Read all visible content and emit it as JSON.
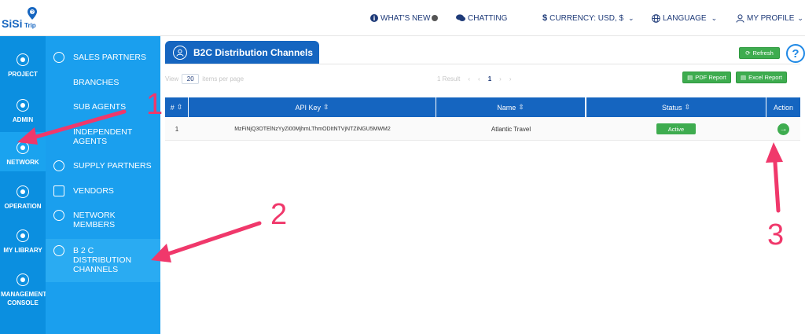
{
  "brand": {
    "name": "SiSi",
    "sub": "Trip"
  },
  "topnav": {
    "whats_new": "WHAT'S NEW",
    "chatting": "CHATTING",
    "currency": "CURRENCY: USD, $",
    "language": "LANGUAGE",
    "profile": "MY PROFILE"
  },
  "rail": [
    {
      "label": "PROJECT"
    },
    {
      "label": "ADMIN"
    },
    {
      "label": "NETWORK"
    },
    {
      "label": "OPERATION"
    },
    {
      "label": "MY LIBRARY"
    },
    {
      "label": "MANAGEMENT CONSOLE"
    }
  ],
  "submenu": [
    {
      "label": "SALES PARTNERS"
    },
    {
      "label": "BRANCHES"
    },
    {
      "label": "SUB AGENTS"
    },
    {
      "label": "INDEPENDENT AGENTS"
    },
    {
      "label": "SUPPLY PARTNERS"
    },
    {
      "label": "VENDORS"
    },
    {
      "label": "NETWORK MEMBERS"
    },
    {
      "label": "B 2 C DISTRIBUTION CHANNELS"
    }
  ],
  "page": {
    "title": "B2C Distribution Channels"
  },
  "toolbar": {
    "refresh": "Refresh",
    "pdf": "PDF Report",
    "excel": "Excel Report",
    "help": "?",
    "view_label": "View",
    "per_page_value": "20",
    "per_page_label": "items per page",
    "result": "1 Result",
    "current_page": "1"
  },
  "table": {
    "headers": [
      "#",
      "API Key",
      "Name",
      "Status",
      "Action"
    ],
    "rows": [
      {
        "num": "1",
        "api_key": "MzFiNjQ3OTElNzYyZi00MjhmLThmODItNTVjNTZiNGU5MWM2",
        "name": "Atlantic Travel",
        "status": "Active"
      }
    ]
  },
  "annotations": {
    "n1": "1",
    "n2": "2",
    "n3": "3"
  },
  "colors": {
    "accent": "#1565c0",
    "rail": "#0b8fe0",
    "submenu": "#1a9fee",
    "green": "#3eac4f",
    "annotation": "#f0386b"
  }
}
